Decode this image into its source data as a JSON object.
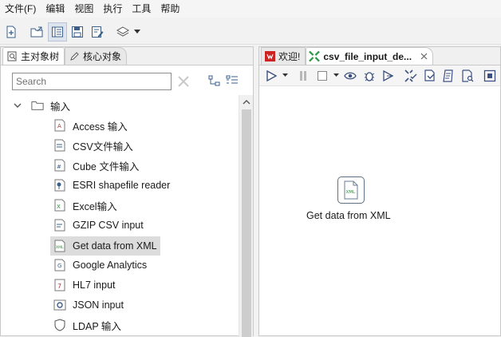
{
  "menubar": {
    "items": [
      "文件(F)",
      "编辑",
      "视图",
      "执行",
      "工具",
      "帮助"
    ]
  },
  "left_panel": {
    "tabs": [
      {
        "label": "主对象树",
        "icon": "magnifier-doc-icon"
      },
      {
        "label": "核心对象",
        "icon": "pencil-icon"
      }
    ],
    "search": {
      "placeholder": "Search",
      "value": ""
    },
    "tree": {
      "folder": {
        "label": "输入",
        "expanded": true
      },
      "items": [
        {
          "label": "Access 输入",
          "icon": "access-input-icon"
        },
        {
          "label": "CSV文件输入",
          "icon": "csv-input-icon"
        },
        {
          "label": "Cube 文件输入",
          "icon": "cube-input-icon"
        },
        {
          "label": "ESRI shapefile reader",
          "icon": "esri-shapefile-icon"
        },
        {
          "label": "Excel输入",
          "icon": "excel-input-icon"
        },
        {
          "label": "GZIP CSV input",
          "icon": "gzip-csv-icon"
        },
        {
          "label": "Get data from XML",
          "icon": "xml-input-icon",
          "selected": true
        },
        {
          "label": "Google Analytics",
          "icon": "google-analytics-icon"
        },
        {
          "label": "HL7 input",
          "icon": "hl7-input-icon"
        },
        {
          "label": "JSON input",
          "icon": "json-input-icon"
        },
        {
          "label": "LDAP 输入",
          "icon": "ldap-input-icon"
        }
      ]
    }
  },
  "right_panel": {
    "tabs": [
      {
        "label": "欢迎!",
        "icon": "welcome-icon",
        "active": false
      },
      {
        "label": "csv_file_input_de...",
        "icon": "transformation-icon",
        "active": true
      }
    ],
    "canvas": {
      "step": {
        "label": "Get data from XML",
        "icon_text": "XML"
      }
    }
  },
  "colors": {
    "accent_blue": "#3a5f8a",
    "run_icon": "#3b4f80",
    "transformation_green": "#2e9b4a",
    "welcome_red": "#cc2222",
    "selected_row": "#dcdcdc"
  }
}
